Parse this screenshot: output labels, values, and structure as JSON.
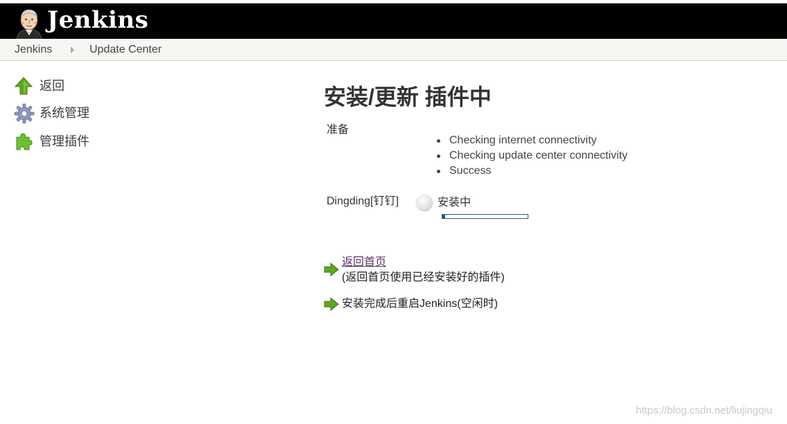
{
  "header": {
    "title": "Jenkins"
  },
  "breadcrumb": {
    "items": [
      "Jenkins",
      "Update Center"
    ]
  },
  "sidebar": {
    "items": [
      {
        "label": "返回",
        "icon": "up-arrow-icon"
      },
      {
        "label": "系统管理",
        "icon": "gear-icon"
      },
      {
        "label": "管理插件",
        "icon": "puzzle-icon"
      }
    ]
  },
  "main": {
    "title": "安装/更新 插件中",
    "preparation": {
      "label": "准备",
      "steps": [
        "Checking internet connectivity",
        "Checking update center connectivity",
        "Success"
      ]
    },
    "plugin": {
      "name": "Dingding[钉钉]",
      "status": "安装中",
      "progress": 0.03
    },
    "actions": [
      {
        "link": "返回首页",
        "description": "(返回首页使用已经安装好的插件)"
      },
      {
        "label": "安装完成后重启Jenkins(空闲时)"
      }
    ]
  },
  "watermark": "https://blog.csdn.net/liujingqiu",
  "colors": {
    "header_bg": "#000000",
    "breadcrumb_bg": "#f6f7f2",
    "link": "#5c3566",
    "progress": "#2d5a8a",
    "arrow_green": "#5da81e"
  }
}
